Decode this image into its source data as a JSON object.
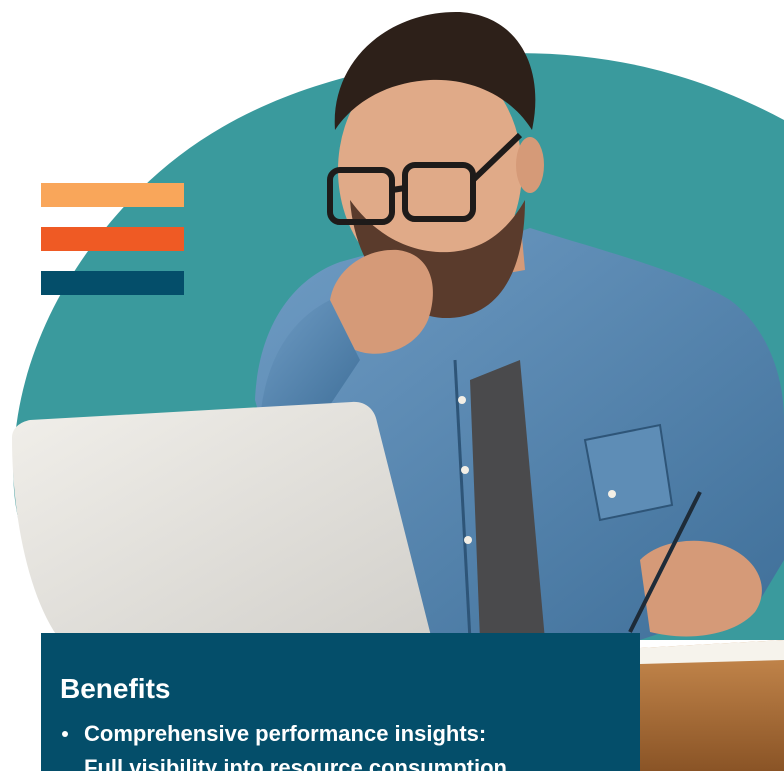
{
  "colors": {
    "background": "#ffffff",
    "blob_teal": "#3a9a9d",
    "stripe_light_orange": "#f9a65a",
    "stripe_orange": "#ef5a24",
    "stripe_navy": "#044e6a",
    "panel_navy": "#044e6a",
    "text_white": "#ffffff"
  },
  "decor": {
    "stripes": [
      "stripe-light-orange",
      "stripe-orange",
      "stripe-navy"
    ],
    "photo": "man-with-glasses-at-laptop-writing-notes"
  },
  "benefits": {
    "title": "Benefits",
    "items": [
      "Comprehensive performance insights:",
      "Full visibility into resource consumption"
    ]
  }
}
